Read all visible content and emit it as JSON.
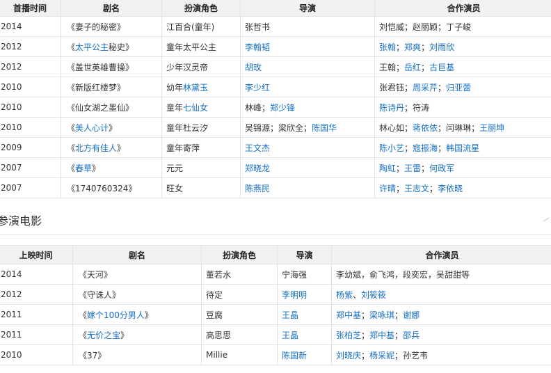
{
  "tv_table": {
    "headers": [
      "首播时间",
      "剧名",
      "扮演角色",
      "导演",
      "合作演员"
    ],
    "rows": [
      {
        "year": "2014",
        "title": [
          {
            "t": "《妻子的秘密》",
            "link": false
          }
        ],
        "role": [
          {
            "t": "江百合(童年)",
            "link": false
          }
        ],
        "director": [
          {
            "t": "张哲书",
            "link": false
          }
        ],
        "costars": [
          {
            "t": "刘恺威",
            "link": false
          },
          {
            "t": "；",
            "link": false
          },
          {
            "t": "赵丽颖",
            "link": false
          },
          {
            "t": "；",
            "link": false
          },
          {
            "t": "丁子峻",
            "link": false
          }
        ]
      },
      {
        "year": "2012",
        "title": [
          {
            "t": "《",
            "link": false
          },
          {
            "t": "太平公主",
            "link": true
          },
          {
            "t": "秘史》",
            "link": false
          }
        ],
        "role": [
          {
            "t": "童年太平公主",
            "link": false
          }
        ],
        "director": [
          {
            "t": "李翰韬",
            "link": true
          }
        ],
        "costars": [
          {
            "t": "张翰",
            "link": true
          },
          {
            "t": "；",
            "link": false
          },
          {
            "t": "郑爽",
            "link": true
          },
          {
            "t": "；",
            "link": false
          },
          {
            "t": "刘雨欣",
            "link": true
          }
        ]
      },
      {
        "year": "2012",
        "title": [
          {
            "t": "《盖世英雄曹操》",
            "link": false
          }
        ],
        "role": [
          {
            "t": "少年汉灵帝",
            "link": false
          }
        ],
        "director": [
          {
            "t": "胡玫",
            "link": true
          }
        ],
        "costars": [
          {
            "t": "王翰",
            "link": false
          },
          {
            "t": "；",
            "link": false
          },
          {
            "t": "岳红",
            "link": true
          },
          {
            "t": "；",
            "link": false
          },
          {
            "t": "古巨基",
            "link": true
          }
        ]
      },
      {
        "year": "2010",
        "title": [
          {
            "t": "《新版红楼梦》",
            "link": false
          }
        ],
        "role": [
          {
            "t": "幼年",
            "link": false
          },
          {
            "t": "林黛玉",
            "link": true
          }
        ],
        "director": [
          {
            "t": "李少红",
            "link": true
          }
        ],
        "costars": [
          {
            "t": "张君钰",
            "link": false
          },
          {
            "t": "；",
            "link": false
          },
          {
            "t": "周采芹",
            "link": true
          },
          {
            "t": "；",
            "link": false
          },
          {
            "t": "归亚蕾",
            "link": true
          }
        ]
      },
      {
        "year": "2010",
        "title": [
          {
            "t": "《仙女湖之墨仙》",
            "link": false
          }
        ],
        "role": [
          {
            "t": "童年",
            "link": false
          },
          {
            "t": "七仙女",
            "link": true
          }
        ],
        "director": [
          {
            "t": "林峰",
            "link": false
          },
          {
            "t": "；",
            "link": false
          },
          {
            "t": "郑少锋",
            "link": true
          }
        ],
        "costars": [
          {
            "t": "陈诗丹",
            "link": true
          },
          {
            "t": "；",
            "link": false
          },
          {
            "t": "符涛",
            "link": false
          }
        ]
      },
      {
        "year": "2010",
        "title": [
          {
            "t": "《",
            "link": false
          },
          {
            "t": "美人心计",
            "link": true
          },
          {
            "t": "》",
            "link": false
          }
        ],
        "role": [
          {
            "t": "童年杜云汐",
            "link": false
          }
        ],
        "director": [
          {
            "t": "吴锦源",
            "link": false
          },
          {
            "t": "；",
            "link": false
          },
          {
            "t": "梁欣全",
            "link": false
          },
          {
            "t": "；",
            "link": false
          },
          {
            "t": "陈国华",
            "link": true
          }
        ],
        "costars": [
          {
            "t": "林心如",
            "link": false
          },
          {
            "t": "；",
            "link": false
          },
          {
            "t": "蒋依依",
            "link": true
          },
          {
            "t": "；",
            "link": false
          },
          {
            "t": "闫琳琳",
            "link": false
          },
          {
            "t": "；",
            "link": false
          },
          {
            "t": "王丽坤",
            "link": true
          }
        ]
      },
      {
        "year": "2009",
        "title": [
          {
            "t": "《",
            "link": false
          },
          {
            "t": "北方有佳人",
            "link": true
          },
          {
            "t": "》",
            "link": false
          }
        ],
        "role": [
          {
            "t": "童年寄萍",
            "link": false
          }
        ],
        "director": [
          {
            "t": "王文杰",
            "link": true
          }
        ],
        "costars": [
          {
            "t": "陈小艺",
            "link": true
          },
          {
            "t": "；",
            "link": false
          },
          {
            "t": "寇振海",
            "link": true
          },
          {
            "t": "；",
            "link": false
          },
          {
            "t": "韩国流星",
            "link": true
          }
        ]
      },
      {
        "year": "2007",
        "title": [
          {
            "t": "《",
            "link": false
          },
          {
            "t": "春草",
            "link": true
          },
          {
            "t": "》",
            "link": false
          }
        ],
        "role": [
          {
            "t": "元元",
            "link": false
          }
        ],
        "director": [
          {
            "t": "郑晓龙",
            "link": true
          }
        ],
        "costars": [
          {
            "t": "陶虹",
            "link": true
          },
          {
            "t": "；",
            "link": false
          },
          {
            "t": "王雷",
            "link": true
          },
          {
            "t": "；",
            "link": false
          },
          {
            "t": "何政军",
            "link": true
          }
        ]
      },
      {
        "year": "2007",
        "title": [
          {
            "t": "《1740760324》",
            "link": false
          }
        ],
        "role": [
          {
            "t": "旺女",
            "link": false
          }
        ],
        "director": [
          {
            "t": "陈燕民",
            "link": true
          }
        ],
        "costars": [
          {
            "t": "许晴",
            "link": true
          },
          {
            "t": "；",
            "link": false
          },
          {
            "t": "王志文",
            "link": true
          },
          {
            "t": "；",
            "link": false
          },
          {
            "t": "李依晓",
            "link": true
          }
        ]
      }
    ]
  },
  "movie_section": {
    "title": "参演电影"
  },
  "movie_table": {
    "headers": [
      "上映时间",
      "剧名",
      "扮演角色",
      "导演",
      "合作演员"
    ],
    "rows": [
      {
        "year": "2014",
        "title": [
          {
            "t": "《天河》",
            "link": false
          }
        ],
        "role": [
          {
            "t": "董若水",
            "link": false
          }
        ],
        "director": [
          {
            "t": "宁海强",
            "link": false
          }
        ],
        "costars": [
          {
            "t": "李幼斌，俞飞鸿，段奕宏，吴甜甜等",
            "link": false
          }
        ]
      },
      {
        "year": "2012",
        "title": [
          {
            "t": "《守诛人》",
            "link": false
          }
        ],
        "role": [
          {
            "t": "待定",
            "link": false
          }
        ],
        "director": [
          {
            "t": "李明明",
            "link": true
          }
        ],
        "costars": [
          {
            "t": "杨紫",
            "link": true
          },
          {
            "t": "、",
            "link": false
          },
          {
            "t": "刘筱筱",
            "link": true
          }
        ]
      },
      {
        "year": "2011",
        "title": [
          {
            "t": "《",
            "link": false
          },
          {
            "t": "嫁个100分男人",
            "link": true
          },
          {
            "t": "》",
            "link": false
          }
        ],
        "role": [
          {
            "t": "豆腐",
            "link": false
          }
        ],
        "director": [
          {
            "t": "王晶",
            "link": true
          }
        ],
        "costars": [
          {
            "t": "郑中基",
            "link": true
          },
          {
            "t": "；",
            "link": false
          },
          {
            "t": "梁咏琪",
            "link": true
          },
          {
            "t": "；",
            "link": false
          },
          {
            "t": "谢娜",
            "link": true
          }
        ]
      },
      {
        "year": "2011",
        "title": [
          {
            "t": "《",
            "link": false
          },
          {
            "t": "无价之宝",
            "link": true
          },
          {
            "t": "》",
            "link": false
          }
        ],
        "role": [
          {
            "t": "高思思",
            "link": false
          }
        ],
        "director": [
          {
            "t": "王晶",
            "link": true
          }
        ],
        "costars": [
          {
            "t": "张柏芝",
            "link": true
          },
          {
            "t": "；",
            "link": false
          },
          {
            "t": "郑中基",
            "link": true
          },
          {
            "t": "；",
            "link": false
          },
          {
            "t": "邵兵",
            "link": true
          }
        ]
      },
      {
        "year": "2010",
        "title": [
          {
            "t": "《37》",
            "link": false
          }
        ],
        "role": [
          {
            "t": "Millie",
            "link": false
          }
        ],
        "director": [
          {
            "t": "陈国新",
            "link": true
          }
        ],
        "costars": [
          {
            "t": "刘晓庆",
            "link": true
          },
          {
            "t": "；",
            "link": false
          },
          {
            "t": "杨采妮",
            "link": true
          },
          {
            "t": "；",
            "link": false
          },
          {
            "t": "孙艺韦",
            "link": false
          }
        ]
      }
    ]
  }
}
